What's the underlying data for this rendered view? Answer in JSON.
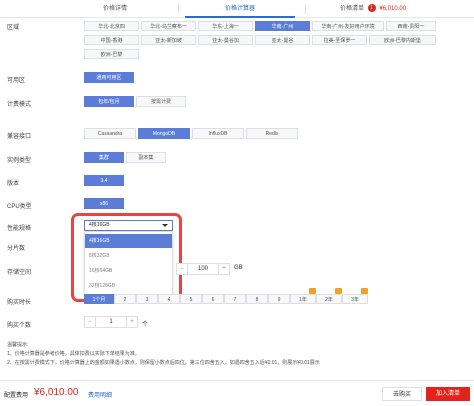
{
  "header": {
    "tabs": [
      "价格详情",
      "价格计算器"
    ],
    "cart_label": "价格清单",
    "cart_count": "1",
    "cart_price": "¥6,010.00"
  },
  "region": {
    "label": "区域",
    "rows": [
      [
        "华北-北京四",
        "华北-乌兰察布一",
        "华东-上海一",
        "华南-广州",
        "华南-广州-友好用户环境",
        "西南-贵阳一"
      ],
      [
        "中国-香港",
        "亚太-新加坡",
        "亚太-曼谷加",
        "亚太-曼谷",
        "拉美-圣保罗一",
        "欧洲-巴黎内斯堡"
      ],
      [
        "欧洲-巴黎"
      ]
    ],
    "selected": "华南-广州"
  },
  "az": {
    "label": "可用区",
    "options": [
      "通用可用区"
    ],
    "selected": "通用可用区"
  },
  "billing": {
    "label": "计费模式",
    "options": [
      "包年/包月",
      "按需计费"
    ],
    "selected": "包年/包月"
  },
  "api": {
    "label": "兼容接口",
    "options": [
      "Cassandra",
      "MongoDB",
      "InfluxDB",
      "Redis"
    ],
    "selected": "MongoDB"
  },
  "instance_type": {
    "label": "实例类型",
    "options": [
      "集群",
      "副本集"
    ],
    "selected": "集群"
  },
  "version": {
    "label": "版本",
    "value": "3.4"
  },
  "cpu": {
    "label": "CPU类型",
    "value": "x86"
  },
  "spec": {
    "label": "性能规格",
    "selected": "4核16GB",
    "options": [
      "4核16GB",
      "8核32GB",
      "16核64GB",
      "32核128GB"
    ]
  },
  "shards": {
    "label": "分片数"
  },
  "storage": {
    "label": "存储空间",
    "value": "100",
    "unit": "GB"
  },
  "duration": {
    "label": "购买时长",
    "options": [
      "1个月",
      "2",
      "3",
      "4",
      "5",
      "6",
      "7",
      "8",
      "9",
      "1年",
      "2年",
      "3年"
    ],
    "selected": "1个月",
    "gift_icon": "gift-icon",
    "gift_color": "#f0a02a"
  },
  "quantity": {
    "label": "购买个数",
    "value": "1",
    "unit": "个"
  },
  "notes": {
    "title": "温馨提示:",
    "lines": [
      "1、价格计算器是参考价格，具体扣费以实际下单结果为准。",
      "2、在按需计费模式下，价格计算器上的金额如果遇小数点，则保留小数点后四位，第三位四舍五入。如遇四舍五入后¥0.01，则展示¥0.01展示"
    ]
  },
  "footer": {
    "config_label": "配置费用",
    "price": "¥6,010.00",
    "detail_link": "费用明细",
    "buy_label": "去购买",
    "add_label": "加入清单"
  },
  "colors": {
    "accent": "#5b7dd8",
    "highlight": "#e64545",
    "price": "#e2231a"
  }
}
